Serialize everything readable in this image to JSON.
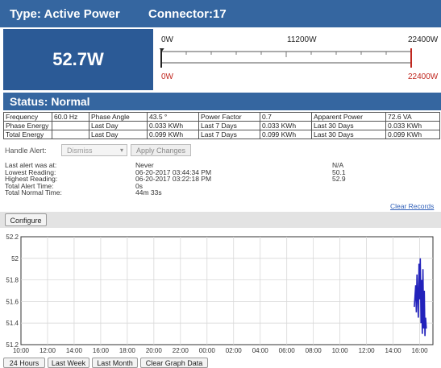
{
  "header": {
    "type_label": "Type: Active Power",
    "connector_label": "Connector:17"
  },
  "reading": {
    "value": "52.7W"
  },
  "gauge": {
    "min_label": "0W",
    "mid_label": "11200W",
    "max_label": "22400W",
    "min_label_red": "0W",
    "max_label_red": "22400W",
    "min": 0,
    "max": 22400,
    "current": 52.7,
    "colors": {
      "normal": "#222222",
      "alert": "#c0271f"
    }
  },
  "status": {
    "label": "Status: Normal"
  },
  "metrics": {
    "rows": [
      [
        "Frequency",
        "60.0 Hz",
        "Phase Angle",
        "43.5 °",
        "Power Factor",
        "0.7",
        "Apparent Power",
        "72.6 VA"
      ],
      [
        "Phase Energy",
        "",
        "Last Day",
        "0.033 KWh",
        "Last 7 Days",
        "0.033 KWh",
        "Last 30 Days",
        "0.033 KWh"
      ],
      [
        "Total Energy",
        "",
        "Last Day",
        "0.099 KWh",
        "Last 7 Days",
        "0.099 KWh",
        "Last 30 Days",
        "0.099 KWh"
      ]
    ]
  },
  "alert": {
    "handle_label": "Handle Alert:",
    "dismiss_value": "Dismiss",
    "apply_label": "Apply Changes"
  },
  "info": {
    "labels": [
      "Last alert was at:",
      "Lowest Reading:",
      "Highest Reading:",
      "Total Alert Time:",
      "Total Normal Time:"
    ],
    "times": [
      "Never",
      "06-20-2017 03:44:34 PM",
      "06-20-2017 03:22:18 PM",
      "0s",
      "44m 33s"
    ],
    "values": [
      "N/A",
      "50.1",
      "52.9",
      "",
      ""
    ]
  },
  "clear_records_label": "Clear Records",
  "configure_label": "Configure",
  "chart_data": {
    "type": "line",
    "y_ticks": [
      "52.2",
      "52",
      "51.8",
      "51.6",
      "51.4",
      "51.2"
    ],
    "x_ticks": [
      "10:00",
      "12:00",
      "14:00",
      "16:00",
      "18:00",
      "20:00",
      "22:00",
      "00:00",
      "02:00",
      "04:00",
      "06:00",
      "08:00",
      "10:00",
      "12:00",
      "14:00",
      "16:00"
    ],
    "ylim": [
      51.2,
      52.2
    ],
    "xlim_hours": [
      0,
      31
    ],
    "series": [
      {
        "color": "#2222bb",
        "x": [
          29.6,
          29.7,
          29.75,
          29.8,
          29.9,
          29.95,
          30.0,
          30.05,
          30.1,
          30.15,
          30.2,
          30.25,
          30.3,
          30.35,
          30.4,
          30.45,
          30.5
        ],
        "y": [
          51.55,
          51.75,
          51.5,
          51.85,
          51.45,
          51.95,
          51.62,
          52.0,
          51.4,
          51.8,
          51.3,
          51.9,
          51.35,
          51.7,
          51.28,
          51.45,
          51.35
        ]
      }
    ],
    "grid": true
  },
  "graph_buttons": [
    "24 Hours",
    "Last Week",
    "Last Month",
    "Clear Graph Data"
  ]
}
